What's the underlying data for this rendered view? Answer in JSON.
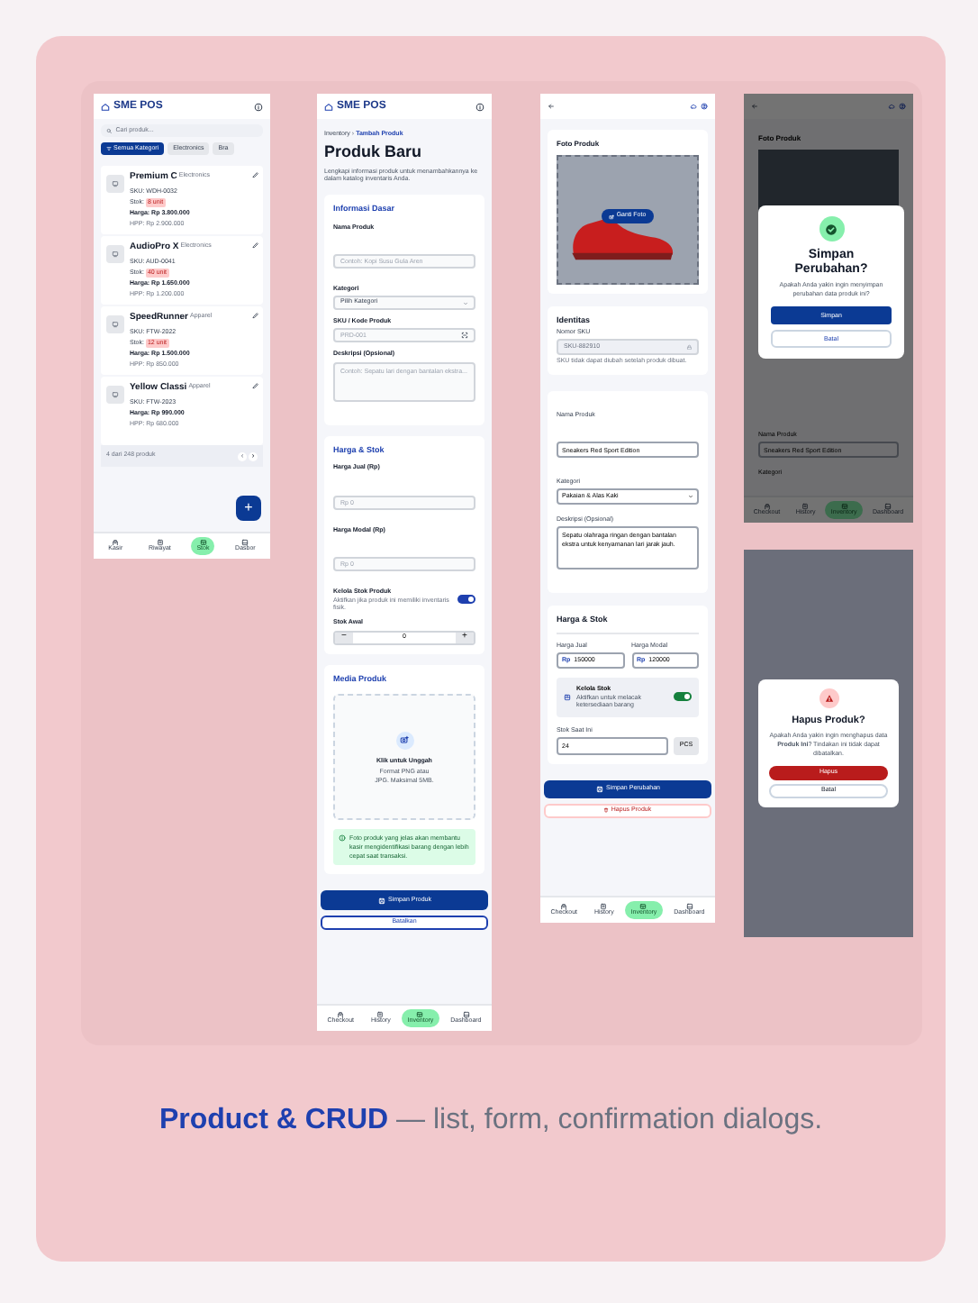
{
  "list_screen": {
    "app_title": "SME POS",
    "search": {
      "placeholder": "Cari produk..."
    },
    "chips": [
      {
        "label": "Semua Kategori",
        "selected": true
      },
      {
        "label": "Electronics",
        "selected": false
      },
      {
        "label": "Bra",
        "selected": false
      }
    ],
    "products": [
      {
        "name": "Premium C",
        "category": "Electronics",
        "sku": "SKU: WDH-0032",
        "stock_label": "Stok:",
        "stock_badge": "8 unit",
        "price": "Harga: Rp 3.800.000",
        "cost": "HPP: Rp 2.900.000"
      },
      {
        "name": "AudioPro X",
        "category": "Electronics",
        "sku": "SKU: AUD-0041",
        "stock_label": "Stok:",
        "stock_badge": "40 unit",
        "price": "Harga: Rp 1.650.000",
        "cost": "HPP: Rp 1.200.000"
      },
      {
        "name": "SpeedRunner",
        "category": "Apparel",
        "sku": "SKU: FTW-2022",
        "stock_label": "Stok:",
        "stock_badge": "12 unit",
        "price": "Harga: Rp 1.500.000",
        "cost": "HPP: Rp 850.000"
      },
      {
        "name": "Yellow Classi",
        "category": "Apparel",
        "sku": "SKU: FTW-2023",
        "price": "Harga: Rp 990.000",
        "cost": "HPP: Rp 680.000"
      }
    ],
    "pagination": {
      "text": "4 dari 248 produk",
      "prev": "‹",
      "next": "›"
    },
    "fab": "+",
    "nav": [
      {
        "label": "Kasir",
        "selected": false
      },
      {
        "label": "Riwayat",
        "selected": false
      },
      {
        "label": "Stok",
        "selected": true
      },
      {
        "label": "Dasbor",
        "selected": false
      }
    ]
  },
  "form_screen": {
    "app_title": "SME POS",
    "breadcrumb": {
      "parent": "Inventory",
      "separator": "›",
      "current": "Tambah Produk"
    },
    "title": "Produk Baru",
    "description": "Lengkapi informasi produk untuk menambahkannya ke dalam katalog inventaris Anda.",
    "basic_info": {
      "title": "Informasi Dasar",
      "fields": [
        {
          "label": "Nama Produk",
          "kind": "text",
          "placeholder": "Contoh: Kopi Susu Gula Aren"
        },
        {
          "label": "Kategori",
          "kind": "select",
          "value": "Pilih Kategori"
        },
        {
          "label": "SKU / Kode Produk",
          "kind": "scan",
          "placeholder": "PRD-001"
        },
        {
          "label": "Deskripsi (Opsional)",
          "kind": "textarea",
          "placeholder": "Contoh: Sepatu lari dengan bantalan ekstra..."
        }
      ]
    },
    "pricing": {
      "title": "Harga & Stok",
      "fields": [
        {
          "label": "Harga Jual (Rp)",
          "placeholder": "Rp 0"
        },
        {
          "label": "Harga Modal (Rp)",
          "placeholder": "Rp 0"
        }
      ],
      "stock_toggle": {
        "label": "Kelola Stok Produk",
        "hint": "Aktifkan jika produk ini memiliki inventaris fisik.",
        "on": true
      },
      "initial_stock": {
        "label": "Stok Awal",
        "minus": "−",
        "value": "0",
        "plus": "+"
      }
    },
    "media": {
      "title": "Media Produk",
      "upload_title": "Klik untuk Unggah",
      "upload_hint": "Format PNG atau JPG. Maksimal 5MB.",
      "tip": "Foto produk yang jelas akan membantu kasir mengidentifikasi barang dengan lebih cepat saat transaksi."
    },
    "save_button": "Simpan Produk",
    "cancel_button": "Batalkan",
    "nav": [
      {
        "label": "Checkout",
        "selected": false
      },
      {
        "label": "History",
        "selected": false
      },
      {
        "label": "Inventory",
        "selected": true
      },
      {
        "label": "Dashboard",
        "selected": false
      }
    ]
  },
  "edit_screen": {
    "photo_title": "Foto Produk",
    "change_photo_button": "Ganti Foto",
    "identity": {
      "title": "Identitas",
      "sku_label": "Nomor SKU",
      "sku_value": "SKU-882910",
      "sku_hint": "SKU tidak dapat diubah setelah produk dibuat."
    },
    "fields": [
      {
        "label": "Nama Produk",
        "kind": "text",
        "value": "Sneakers Red Sport Edition"
      },
      {
        "label": "Kategori",
        "kind": "select",
        "value": "Pakaian & Alas Kaki"
      },
      {
        "label": "Deskripsi (Opsional)",
        "kind": "textarea",
        "value": "Sepatu olahraga ringan dengan bantalan ekstra untuk kenyamanan lari jarak jauh."
      }
    ],
    "pricing": {
      "title": "Harga & Stok",
      "prices": [
        {
          "label": "Harga Jual",
          "prefix": "Rp",
          "value": "150000"
        },
        {
          "label": "Harga Modal",
          "prefix": "Rp",
          "value": "120000"
        }
      ],
      "stock_toggle": {
        "label": "Kelola Stok",
        "hint": "Aktifkan untuk melacak ketersediaan barang",
        "on": true
      },
      "current_stock": {
        "label": "Stok Saat Ini",
        "value": "24",
        "unit": "PCS"
      }
    },
    "save_button": "Simpan Perubahan",
    "delete_button": "Hapus Produk",
    "nav": [
      {
        "label": "Checkout",
        "selected": false
      },
      {
        "label": "History",
        "selected": false
      },
      {
        "label": "Inventory",
        "selected": true
      },
      {
        "label": "Dashboard",
        "selected": false
      }
    ]
  },
  "save_dialog_screen": {
    "background": {
      "photo_title": "Foto Produk",
      "name_label": "Nama Produk",
      "name_value": "Sneakers Red Sport Edition",
      "category_label": "Kategori",
      "nav": [
        {
          "label": "Checkout",
          "selected": false
        },
        {
          "label": "History",
          "selected": false
        },
        {
          "label": "Inventory",
          "selected": true
        },
        {
          "label": "Dashboard",
          "selected": false
        }
      ]
    },
    "dialog": {
      "title": "Simpan Perubahan?",
      "message": "Apakah Anda yakin ingin menyimpan perubahan data produk ini?",
      "confirm_button": "Simpan",
      "cancel_button": "Batal"
    }
  },
  "delete_dialog_screen": {
    "dialog": {
      "title": "Hapus Produk?",
      "message": "Apakah Anda yakin ingin menghapus data **Produk Ini**? Tindakan ini tidak dapat dibatalkan.",
      "confirm_button": "Hapus",
      "cancel_button": "Batal"
    }
  },
  "caption": {
    "text": "**Product & CRUD** — list, form, confirmation dialogs."
  }
}
